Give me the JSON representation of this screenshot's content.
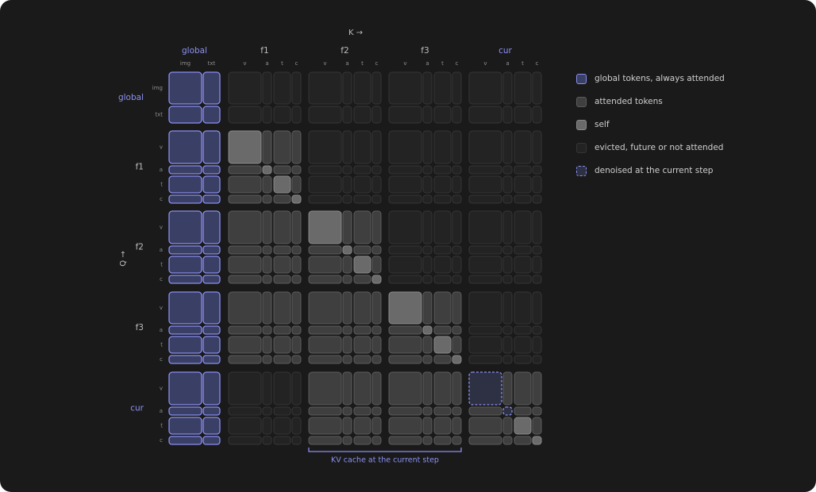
{
  "key_axis_label": "K →",
  "query_axis_label": "Q →",
  "groups": [
    {
      "label": "global",
      "highlight": true,
      "sub": [
        "img",
        "txt"
      ]
    },
    {
      "label": "f1",
      "highlight": false,
      "sub": [
        "v",
        "a",
        "t",
        "c"
      ]
    },
    {
      "label": "f2",
      "highlight": false,
      "sub": [
        "v",
        "a",
        "t",
        "c"
      ]
    },
    {
      "label": "f3",
      "highlight": false,
      "sub": [
        "v",
        "a",
        "t",
        "c"
      ]
    },
    {
      "label": "cur",
      "highlight": true,
      "sub": [
        "v",
        "a",
        "t",
        "c"
      ]
    }
  ],
  "kv_cache_label": "KV cache at the current step",
  "colors": {
    "global_fill": "#3a3f66",
    "global_stroke": "#8b8ff0",
    "attended_fill": "#3f3f3f",
    "attended_stroke": "#5c5c5c",
    "self_fill": "#6a6a6a",
    "self_stroke": "#8a8a8a",
    "evicted_fill": "#232323",
    "evicted_stroke": "#353535",
    "highlight_text": "#8d91f5",
    "label_text": "#bdbdbd",
    "small_label_text": "#8e8e8e"
  },
  "legend": [
    {
      "type": "global",
      "label": "global tokens, always attended"
    },
    {
      "type": "attended",
      "label": "attended tokens"
    },
    {
      "type": "self",
      "label": "self"
    },
    {
      "type": "evicted",
      "label": "evicted, future or not attended"
    },
    {
      "type": "denoised",
      "label": "denoised at the current step"
    }
  ]
}
